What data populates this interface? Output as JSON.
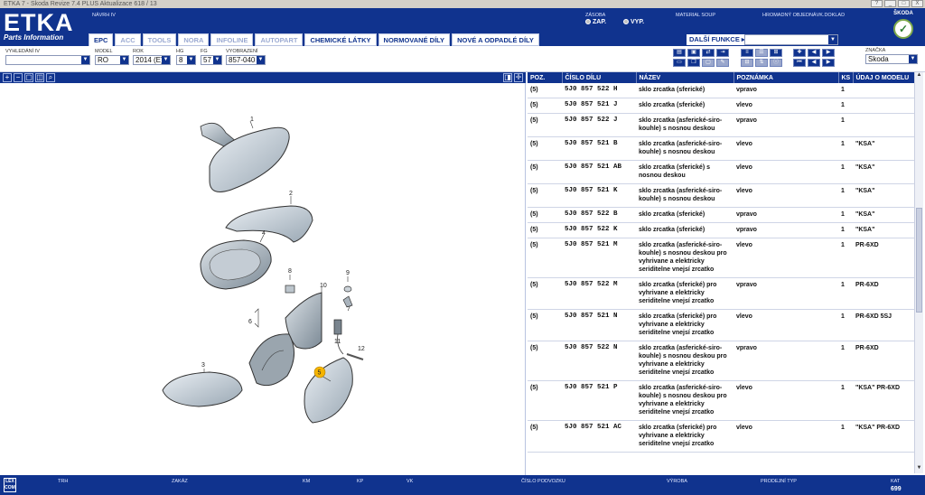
{
  "window": {
    "title": "ETKA 7 - Skoda Revize 7.4 PLUS Aktualizace 618 / 13",
    "controls": [
      "?",
      "_",
      "□",
      "X"
    ]
  },
  "header": {
    "logo": "ETKA",
    "logo_sub": "Parts Information",
    "navrh_label": "NÁVRH IV",
    "zasoba_label": "ZÁSOBA",
    "zap_label": "ZAP.",
    "vyp_label": "VYP.",
    "material_label": "MATERIAL SOUP",
    "hromadny_label": "HROMADNÝ OBJEDNÁVK.DOKLAD",
    "brand": "ŠKODA"
  },
  "tabs": [
    {
      "label": "EPC",
      "active": true
    },
    {
      "label": "ACC"
    },
    {
      "label": "TOOLS"
    },
    {
      "label": "NORA"
    },
    {
      "label": "INFOLINE"
    },
    {
      "label": "AUTOPART"
    },
    {
      "label": "CHEMICKÉ LÁTKY"
    },
    {
      "label": "NORMOVANÉ DÍLY"
    },
    {
      "label": "NOVÉ A ODPADLÉ DÍLY"
    }
  ],
  "toolbar": {
    "vyhledani_label": "VYHLEDÁNÍ IV",
    "vyhledani_value": "",
    "model_label": "MODEL",
    "model_value": "RO",
    "rok_label": "ROK",
    "rok_value": "2014 (E)",
    "hg_label": "HG",
    "hg_value": "8",
    "fg_label": "FG",
    "fg_value": "57",
    "vyobrazeni_label": "VYOBRAZENÍ",
    "vyobrazeni_value": "857-040",
    "dalsi_funkce": "DALŠÍ FUNKCE ▸",
    "dalsi_value": "",
    "znacka_label": "ZNAČKA",
    "znacka_value": "Skoda"
  },
  "illustration": {
    "callouts": [
      "1",
      "2",
      "4",
      "8",
      "9",
      "10",
      "7",
      "6",
      "3",
      "11",
      "12",
      "5"
    ],
    "highlight_color": "#f5b400"
  },
  "table": {
    "headers": [
      "POZ.",
      "ČÍSLO DÍLU",
      "NÁZEV",
      "POZNÁMKA",
      "KS",
      "ÚDAJ O MODELU"
    ],
    "rows": [
      {
        "poz": "(5)",
        "part": "5J0  857  522  H",
        "name": "sklo zrcatka (sferické)",
        "note": "vpravo",
        "ks": "1",
        "model": ""
      },
      {
        "poz": "(5)",
        "part": "5J0  857  521  J",
        "name": "sklo zrcatka (sferické)",
        "note": "vlevo",
        "ks": "1",
        "model": ""
      },
      {
        "poz": "(5)",
        "part": "5J0  857  522  J",
        "name": "sklo zrcatka (asferické-siro-kouhle) s nosnou deskou",
        "note": "vpravo",
        "ks": "1",
        "model": ""
      },
      {
        "poz": "(5)",
        "part": "5J0  857  521  B",
        "name": "sklo zrcatka (asferické-siro-kouhle) s nosnou deskou",
        "note": "vlevo",
        "ks": "1",
        "model": "\"KSA\""
      },
      {
        "poz": "(5)",
        "part": "5J0  857  521  AB",
        "name": "sklo zrcatka (sferické) s nosnou deskou",
        "note": "vlevo",
        "ks": "1",
        "model": "\"KSA\""
      },
      {
        "poz": "(5)",
        "part": "5J0  857  521  K",
        "name": "sklo zrcatka (asferické-siro-kouhle) s nosnou deskou",
        "note": "vlevo",
        "ks": "1",
        "model": "\"KSA\""
      },
      {
        "poz": "(5)",
        "part": "5J0  857  522  B",
        "name": "sklo zrcatka (sferické)",
        "note": "vpravo",
        "ks": "1",
        "model": "\"KSA\""
      },
      {
        "poz": "(5)",
        "part": "5J0  857  522  K",
        "name": "sklo zrcatka (sferické)",
        "note": "vpravo",
        "ks": "1",
        "model": "\"KSA\""
      },
      {
        "poz": "(5)",
        "part": "5J0  857  521  M",
        "name": "sklo zrcatka (asferické-siro-kouhle) s nosnou deskou pro vyhrivane a elektricky seriditelne vnejsí zrcatko",
        "note": "vlevo",
        "ks": "1",
        "model": "PR-6XD"
      },
      {
        "poz": "(5)",
        "part": "5J0  857  522  M",
        "name": "sklo zrcatka (sferické) pro vyhrivane a elektricky seriditelne vnejsí zrcatko",
        "note": "vpravo",
        "ks": "1",
        "model": "PR-6XD"
      },
      {
        "poz": "(5)",
        "part": "5J0  857  521  N",
        "name": "sklo zrcatka (sferické) pro vyhrivane a elektricky seriditelne vnejsí zrcatko",
        "note": "vlevo",
        "ks": "1",
        "model": "PR-6XD 5SJ"
      },
      {
        "poz": "(5)",
        "part": "5J0  857  522  N",
        "name": "sklo zrcatka (asferické-siro-kouhle) s nosnou deskou pro vyhrivane a elektricky seriditelne vnejsí zrcatko",
        "note": "vpravo",
        "ks": "1",
        "model": "PR-6XD"
      },
      {
        "poz": "(5)",
        "part": "5J0  857  521  P",
        "name": "sklo zrcatka (asferické-siro-kouhle) s nosnou deskou pro vyhrivane a elektricky seriditelne vnejsí zrcatko",
        "note": "vlevo",
        "ks": "1",
        "model": "\"KSA\" PR-6XD"
      },
      {
        "poz": "(5)",
        "part": "5J0  857  521  AC",
        "name": "sklo zrcatka (sferické) pro vyhrivane a elektricky seriditelne vnejsí zrcatko",
        "note": "vlevo",
        "ks": "1",
        "model": "\"KSA\" PR-6XD"
      }
    ]
  },
  "status": {
    "lex": "LEX COM",
    "trh": "TRH",
    "zakaz": "ZAKÁZ",
    "km": "KM",
    "kp": "KP",
    "vk": "VK",
    "cislo": "ČÍSLO PODVOZKU",
    "vyroba": "VÝROBA",
    "prodejni": "PRODEJNÍ TYP",
    "kat_label": "KAT",
    "kat_value": "699"
  }
}
